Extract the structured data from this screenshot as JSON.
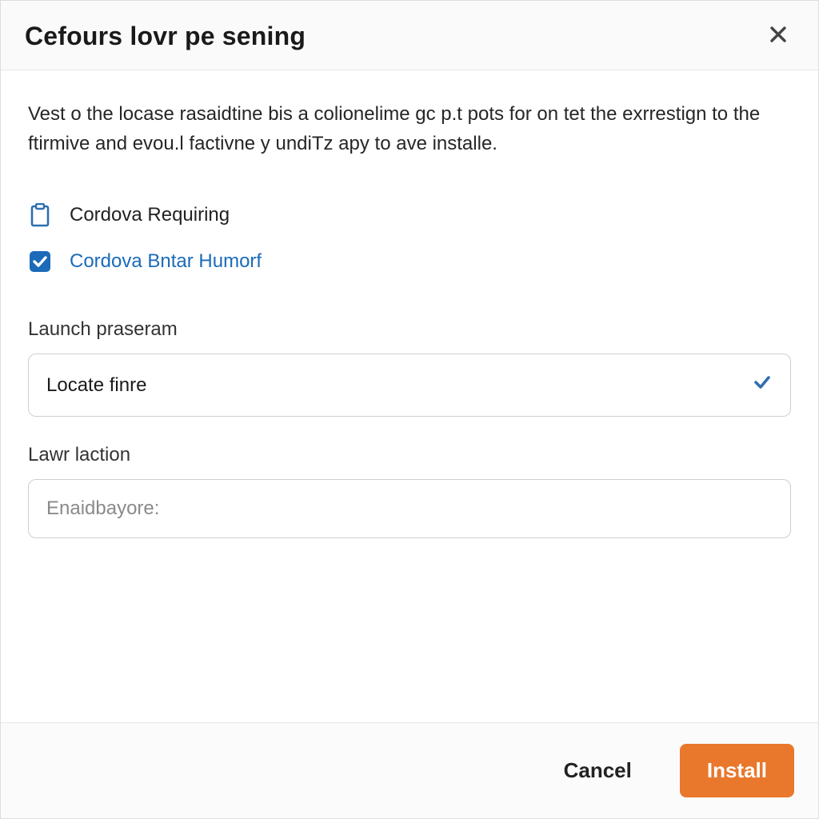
{
  "dialog": {
    "title": "Cefours lovr pe sening",
    "description": "Vest o the locase rasaidtine bis a colionelime gc p.t pots for on tet the exrrestign to the ftirmive and evou.l factivne y undiTz apy to ave installe."
  },
  "options": {
    "item1": {
      "label": "Cordova Requiring",
      "icon": "clipboard-icon"
    },
    "item2": {
      "label": "Cordova Bntar Humorf",
      "checked": true
    }
  },
  "fields": {
    "launch": {
      "label": "Launch praseram",
      "value": "Locate finre"
    },
    "location": {
      "label": "Lawr laction",
      "placeholder": "Enaidbayore:"
    }
  },
  "buttons": {
    "cancel": "Cancel",
    "install": "Install"
  },
  "colors": {
    "accent": "#1b6bb8",
    "primary": "#e9772c"
  }
}
